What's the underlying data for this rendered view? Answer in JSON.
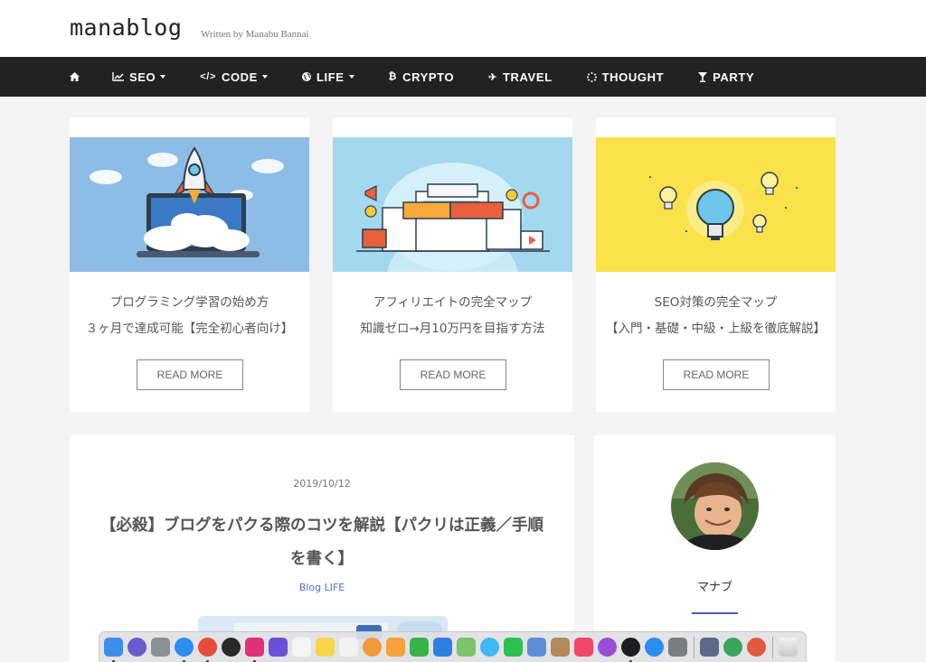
{
  "header": {
    "logo": "manablog",
    "tagline": "Written by Manabu Bannai"
  },
  "nav": {
    "items": [
      {
        "label": "SEO",
        "icon": "chart-line-icon",
        "dropdown": true
      },
      {
        "label": "CODE",
        "icon": "code-icon",
        "dropdown": true
      },
      {
        "label": "LIFE",
        "icon": "globe-icon",
        "dropdown": true
      },
      {
        "label": "CRYPTO",
        "icon": "bitcoin-icon",
        "dropdown": false
      },
      {
        "label": "TRAVEL",
        "icon": "plane-icon",
        "dropdown": false
      },
      {
        "label": "THOUGHT",
        "icon": "spinner-icon",
        "dropdown": false
      },
      {
        "label": "PARTY",
        "icon": "cocktail-icon",
        "dropdown": false
      }
    ]
  },
  "cards": [
    {
      "line1": "プログラミング学習の始め方",
      "line2": "３ヶ月で達成可能【完全初心者向け】",
      "button": "READ MORE",
      "image": "rocket-laptop-icon",
      "bg": "#8dbde6"
    },
    {
      "line1": "アフィリエイトの完全マップ",
      "line2": "知識ゼロ→月10万円を目指す方法",
      "button": "READ MORE",
      "image": "handshake-icon",
      "bg": "#a3d8ee"
    },
    {
      "line1": "SEO対策の完全マップ",
      "line2": "【入門・基礎・中級・上級を徹底解説】",
      "button": "READ MORE",
      "image": "lightbulb-icon",
      "bg": "#fbe14a"
    }
  ],
  "article": {
    "date": "2019/10/12",
    "title": "【必殺】ブログをパクる際のコツを解説【パクリは正義／手順を書く】",
    "categories": "Blog LIFE"
  },
  "sidebar": {
    "author": "マナブ"
  },
  "colors": {
    "nav_bg": "#222222",
    "accent": "#4a56c9",
    "link": "#4a74c9"
  },
  "dock": {
    "apps": [
      {
        "name": "finder-icon",
        "color": "#3d8ee8",
        "running": true
      },
      {
        "name": "siri-icon",
        "color": "#6a5acd",
        "running": false
      },
      {
        "name": "launchpad-icon",
        "color": "#8b8f96",
        "running": false
      },
      {
        "name": "safari-icon",
        "color": "#2b8ef0",
        "running": true
      },
      {
        "name": "chrome-icon",
        "color": "#e84c3d",
        "running": true
      },
      {
        "name": "quicktime-icon",
        "color": "#2a2a2a",
        "running": false
      },
      {
        "name": "slack-icon",
        "color": "#e0307a",
        "running": true
      },
      {
        "name": "imovie-icon",
        "color": "#6b4fd8",
        "running": false
      },
      {
        "name": "calendar-icon",
        "color": "#f5f5f5",
        "running": false
      },
      {
        "name": "notes-icon",
        "color": "#f7d44a",
        "running": false
      },
      {
        "name": "reminders-icon",
        "color": "#f2f2f2",
        "running": false
      },
      {
        "name": "photos-icon",
        "color": "#f19a38",
        "running": false
      },
      {
        "name": "pages-icon",
        "color": "#f4a23a",
        "running": false
      },
      {
        "name": "numbers-icon",
        "color": "#35b44a",
        "running": false
      },
      {
        "name": "keynote-icon",
        "color": "#2f7fe0",
        "running": false
      },
      {
        "name": "maps-icon",
        "color": "#7cc36a",
        "running": false
      },
      {
        "name": "messages-icon",
        "color": "#3fb8f5",
        "running": false
      },
      {
        "name": "facetime-icon",
        "color": "#2cc150",
        "running": false
      },
      {
        "name": "preview-icon",
        "color": "#5d8fd6",
        "running": false
      },
      {
        "name": "contacts-icon",
        "color": "#b08b58",
        "running": false
      },
      {
        "name": "music-icon",
        "color": "#f0476a",
        "running": false
      },
      {
        "name": "podcasts-icon",
        "color": "#9a4fd9",
        "running": false
      },
      {
        "name": "apple-tv-icon",
        "color": "#1d1d1f",
        "running": true
      },
      {
        "name": "app-store-icon",
        "color": "#2d8cf0",
        "running": false
      },
      {
        "name": "system-preferences-icon",
        "color": "#7a7d82",
        "running": false
      },
      {
        "name": "screenshot-icon",
        "color": "#5a6a8a",
        "running": false
      },
      {
        "name": "chrome-canary-icon",
        "color": "#3aa55c",
        "running": false
      },
      {
        "name": "chrome-alt-icon",
        "color": "#e05a3d",
        "running": false
      }
    ],
    "trash": "trash-icon"
  }
}
